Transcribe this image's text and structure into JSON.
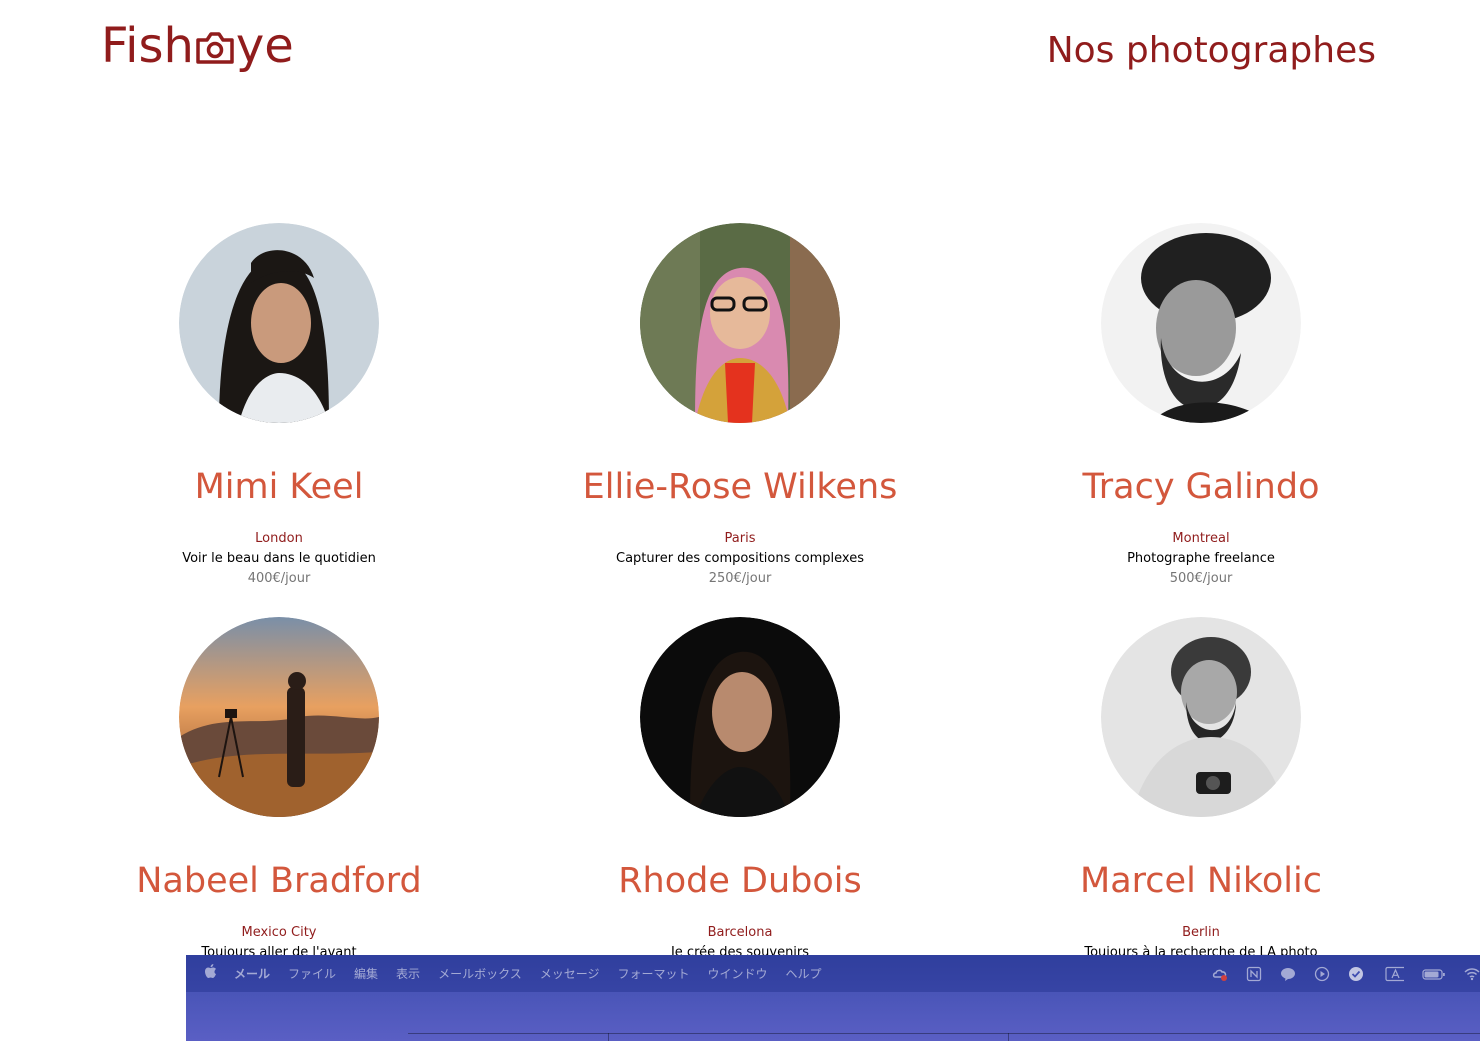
{
  "header": {
    "logo_text_left": "Fish",
    "logo_text_right": "ye",
    "title": "Nos photographes"
  },
  "colors": {
    "brand": "#901C1C",
    "name": "#D3573C",
    "price": "#757575"
  },
  "photographers": [
    {
      "name": "Mimi Keel",
      "city": "London",
      "tagline": "Voir le beau dans le quotidien",
      "price": "400€/jour"
    },
    {
      "name": "Ellie-Rose Wilkens",
      "city": "Paris",
      "tagline": "Capturer des compositions complexes",
      "price": "250€/jour"
    },
    {
      "name": "Tracy Galindo",
      "city": "Montreal",
      "tagline": "Photographe freelance",
      "price": "500€/jour"
    },
    {
      "name": "Nabeel Bradford",
      "city": "Mexico City",
      "tagline": "Toujours aller de l'avant",
      "price": ""
    },
    {
      "name": "Rhode Dubois",
      "city": "Barcelona",
      "tagline": "Je crée des souvenirs",
      "price": ""
    },
    {
      "name": "Marcel Nikolic",
      "city": "Berlin",
      "tagline": "Toujours à la recherche de LA photo",
      "price": ""
    }
  ],
  "menubar": {
    "app": "メール",
    "items": [
      "ファイル",
      "編集",
      "表示",
      "メールボックス",
      "メッセージ",
      "フォーマット",
      "ウインドウ",
      "ヘルプ"
    ],
    "status_icons": [
      "creative-cloud-icon",
      "notion-icon",
      "line-icon",
      "play-icon",
      "check-icon",
      "input-method-icon",
      "battery-icon",
      "wifi-icon"
    ]
  }
}
